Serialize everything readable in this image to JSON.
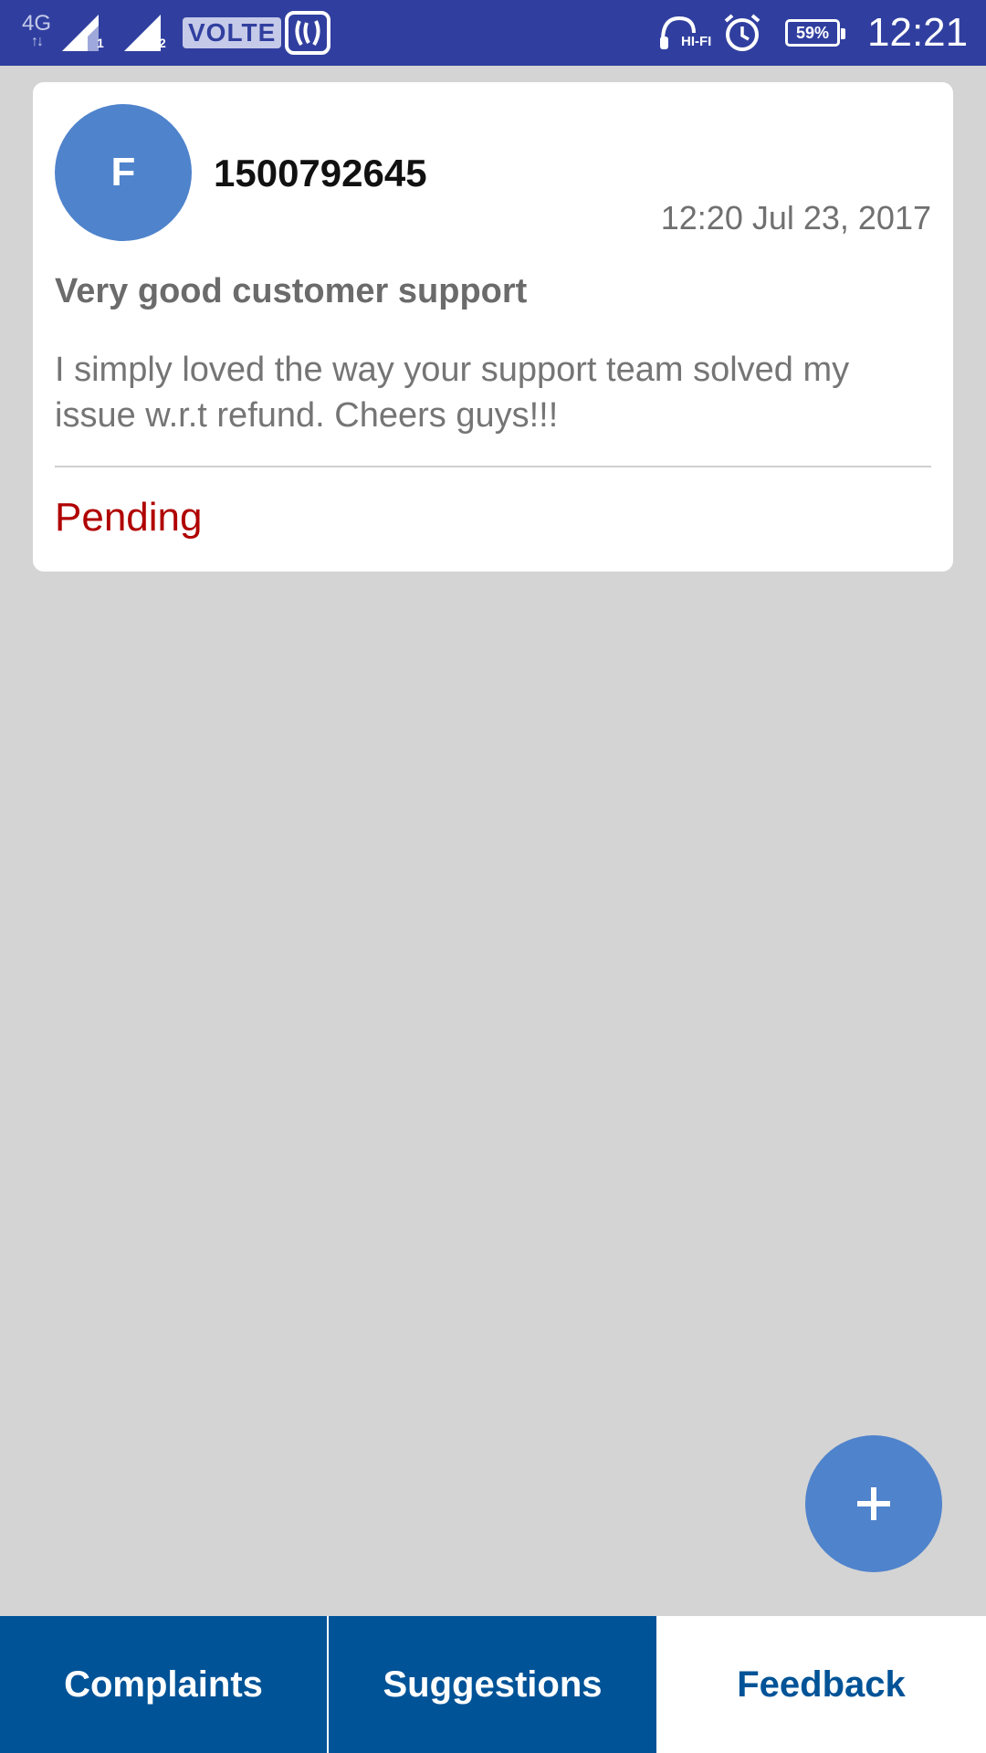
{
  "status_bar": {
    "network": "4G",
    "sim1_label": "1",
    "sim2_label": "2",
    "volte": "VOLTE",
    "hifi": "HI-FI",
    "battery": "59%",
    "time": "12:21",
    "icons": [
      "signal-icon",
      "saavn-icon",
      "headphones-icon",
      "alarm-icon",
      "battery-icon"
    ]
  },
  "card": {
    "avatar_letter": "F",
    "ticket_id": "1500792645",
    "timestamp": "12:20 Jul 23, 2017",
    "subject": "Very good customer support",
    "message": "I simply loved the way your support team solved my issue w.r.t refund. Cheers guys!!!",
    "status": "Pending"
  },
  "fab": {
    "icon": "plus-icon"
  },
  "tabs": [
    {
      "label": "Complaints",
      "active": false
    },
    {
      "label": "Suggestions",
      "active": false
    },
    {
      "label": "Feedback",
      "active": true
    }
  ],
  "colors": {
    "status_bar": "#303f9f",
    "accent": "#4f83cc",
    "tab_bar": "#005397",
    "pending": "#b00000",
    "background": "#d4d4d4"
  }
}
